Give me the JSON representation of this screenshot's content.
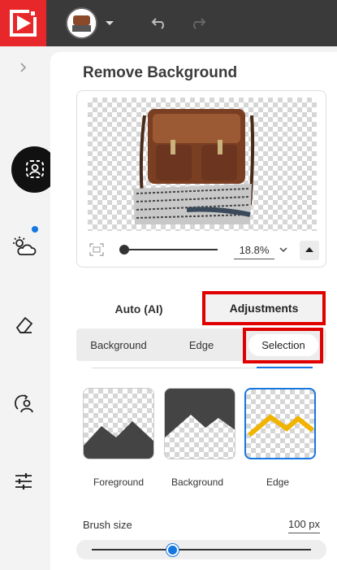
{
  "header": {
    "logo": "app-logo",
    "icons": [
      "photo-thumbnail",
      "chevron-down-icon",
      "undo-icon",
      "redo-icon"
    ]
  },
  "sidebar": {
    "icons": [
      "chevron-right-icon",
      "remove-background-icon",
      "weather-icon",
      "eraser-icon",
      "person-swap-icon",
      "sliders-icon"
    ],
    "notification_color": "#1677e0"
  },
  "panel": {
    "title": "Remove Background",
    "zoom": "18.8%"
  },
  "tabs": {
    "auto": "Auto (AI)",
    "adjustments": "Adjustments"
  },
  "segments": {
    "background": "Background",
    "edge": "Edge",
    "selection": "Selection"
  },
  "modes": [
    {
      "label": "Foreground"
    },
    {
      "label": "Background"
    },
    {
      "label": "Edge"
    }
  ],
  "brush": {
    "label": "Brush size",
    "value": "100 px",
    "level": 0.37
  },
  "colors": {
    "accent": "#1677e0",
    "highlight": "#e00000",
    "brand": "#e8272a"
  }
}
